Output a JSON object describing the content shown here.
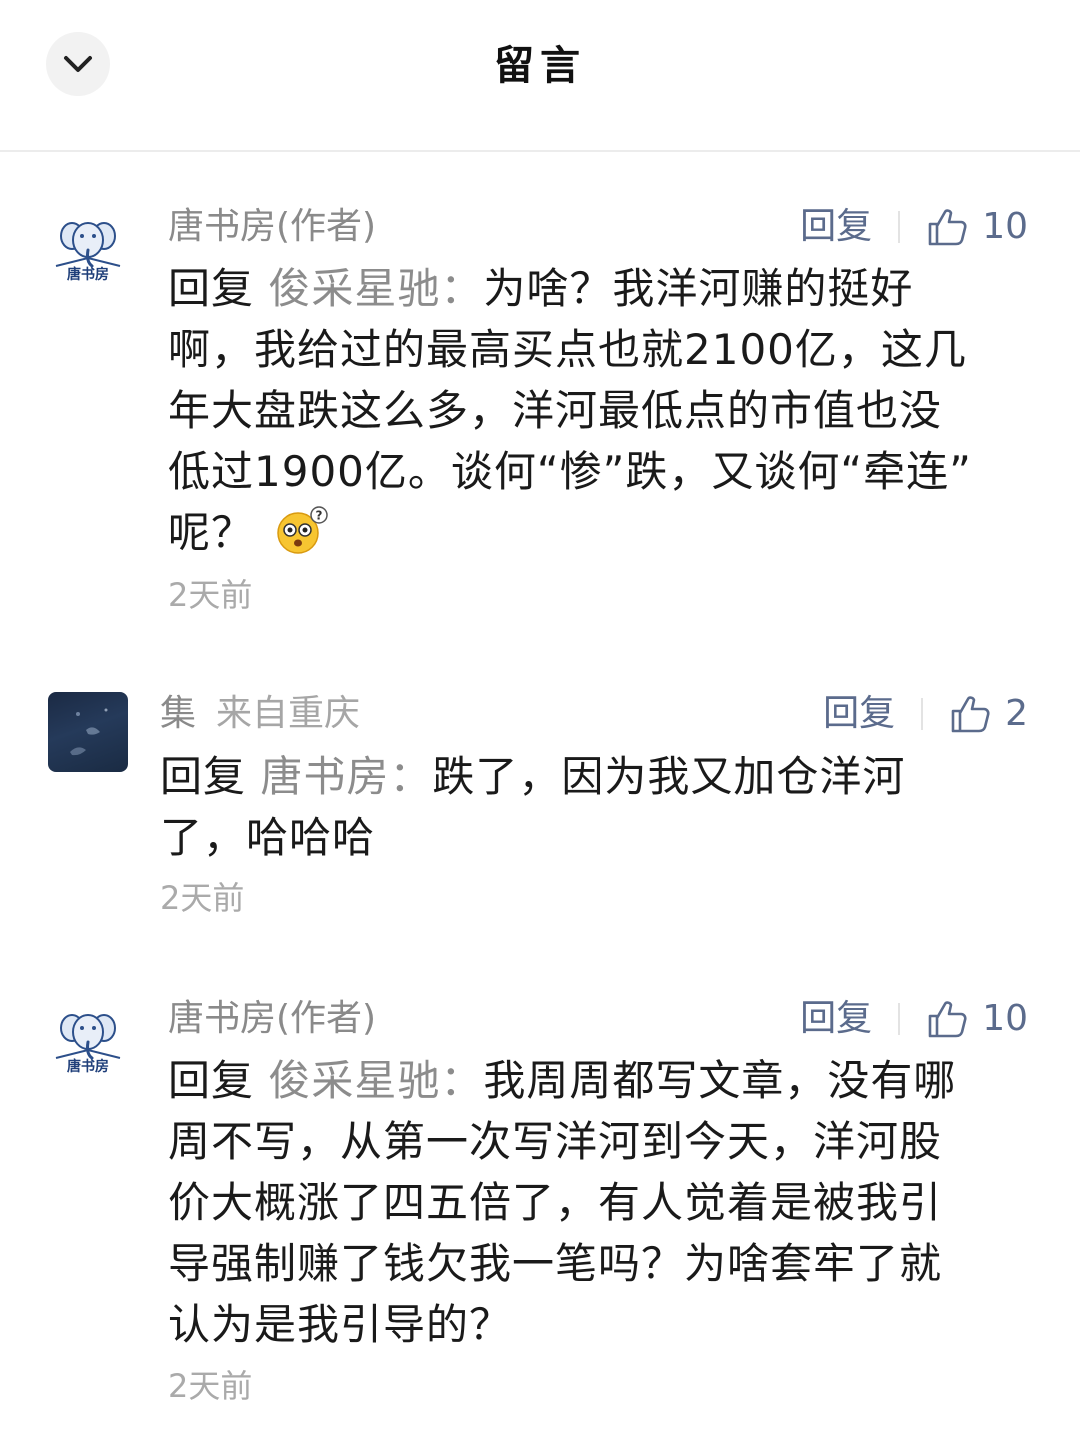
{
  "header": {
    "title": "留言",
    "back_icon": "chevron-down-icon"
  },
  "comments": [
    {
      "author": "唐书房(作者)",
      "location": "",
      "avatar_text": "唐书房",
      "reply_label": "回复",
      "likes": "10",
      "reply_prefix": "回复",
      "reply_target": "俊采星驰：",
      "lines": [
        "为啥？我洋河赚的挺好",
        "啊，我给过的最高买点也就2100亿，这几",
        "年大盘跌这么多，洋河最低点的市值也没",
        "低过1900亿。谈何“惨”跌，又谈何“牵连”",
        "呢？"
      ],
      "emoji": "dizzy-face-emoji",
      "time": "2天前"
    },
    {
      "author": "集",
      "location": "来自重庆",
      "reply_label": "回复",
      "likes": "2",
      "reply_prefix": "回复",
      "reply_target": "唐书房：",
      "lines": [
        "跌了，因为我又加仓洋河",
        "了，哈哈哈"
      ],
      "time": "2天前"
    },
    {
      "author": "唐书房(作者)",
      "location": "",
      "avatar_text": "唐书房",
      "reply_label": "回复",
      "likes": "10",
      "reply_prefix": "回复",
      "reply_target": "俊采星驰：",
      "lines": [
        "我周周都写文章，没有哪",
        "周不写，从第一次写洋河到今天，洋河股",
        "价大概涨了四五倍了，有人觉着是被我引",
        "导强制赚了钱欠我一笔吗？为啥套牢了就",
        "认为是我引导的？"
      ],
      "time": "2天前"
    }
  ],
  "colors": {
    "action_blue": "#5b6b8c",
    "name_gray": "#8a8a8a",
    "time_gray": "#aaaaaa"
  }
}
